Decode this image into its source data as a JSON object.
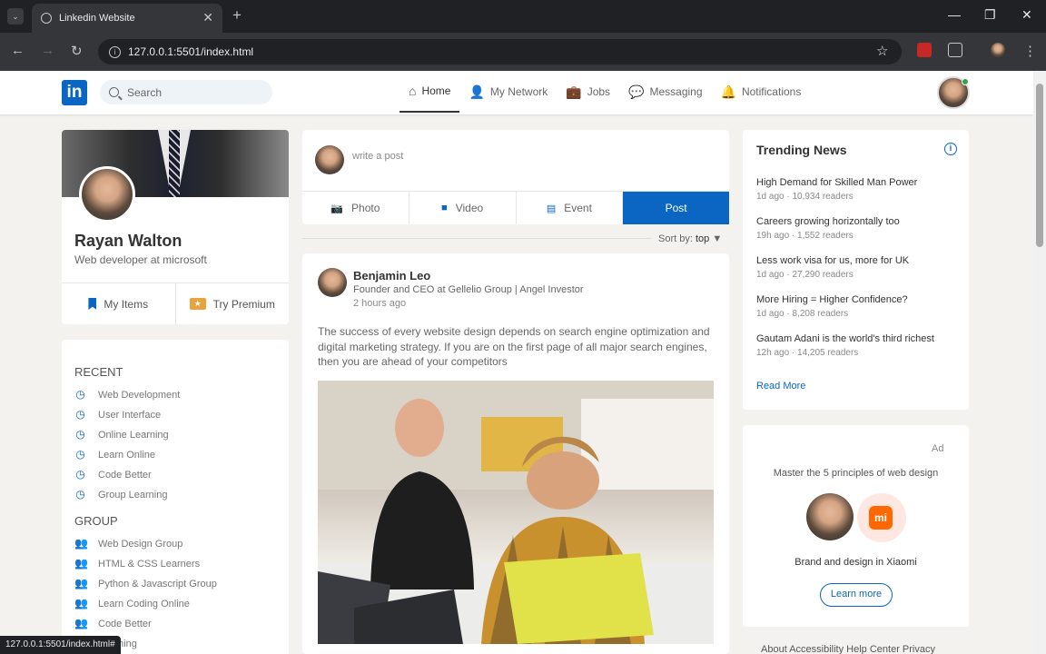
{
  "browser": {
    "tab_title": "Linkedin Website",
    "url": "127.0.0.1:5501/index.html",
    "status_url": "127.0.0.1:5501/index.html#"
  },
  "navbar": {
    "logo": "in",
    "search_placeholder": "Search",
    "items": [
      {
        "label": "Home",
        "icon": "home-icon"
      },
      {
        "label": "My Network",
        "icon": "people-icon"
      },
      {
        "label": "Jobs",
        "icon": "briefcase-icon"
      },
      {
        "label": "Messaging",
        "icon": "message-icon"
      },
      {
        "label": "Notifications",
        "icon": "bell-icon"
      }
    ]
  },
  "profile": {
    "name": "Rayan Walton",
    "role": "Web developer at microsoft",
    "my_items": "My Items",
    "try_premium": "Try Premium"
  },
  "sidebar": {
    "recent_title": "RECENT",
    "recent": [
      "Web Development",
      "User Interface",
      "Online Learning",
      "Learn Online",
      "Code Better",
      "Group Learning"
    ],
    "group_title": "GROUP",
    "groups": [
      "Web Design Group",
      "HTML & CSS Learners",
      "Python & Javascript Group",
      "Learn Coding Online",
      "Code Better",
      "Learning"
    ]
  },
  "composer": {
    "placeholder": "write a post",
    "photo": "Photo",
    "video": "Video",
    "event": "Event",
    "post": "Post"
  },
  "sort": {
    "label": "Sort by:",
    "value": "top"
  },
  "post": {
    "author": "Benjamin Leo",
    "title": "Founder and CEO at Gellelio Group | Angel Investor",
    "time": "2 hours ago",
    "text": "The success of every website design depends on search engine optimization and digital marketing strategy. If you are on the first page of all major search engines, then you are ahead of your competitors"
  },
  "trending": {
    "title": "Trending News",
    "items": [
      {
        "headline": "High Demand for Skilled Man Power",
        "meta": "1d ago · 10,934 readers"
      },
      {
        "headline": "Careers growing horizontally too",
        "meta": "19h ago · 1,552 readers"
      },
      {
        "headline": "Less work visa for us, more for UK",
        "meta": "1d ago · 27,290 readers"
      },
      {
        "headline": "More Hiring = Higher Confidence?",
        "meta": "1d ago · 8,208 readers"
      },
      {
        "headline": "Gautam Adani is the world's third richest",
        "meta": "12h ago · 14,205 readers"
      }
    ],
    "read_more": "Read More"
  },
  "ad": {
    "label": "Ad",
    "text": "Master the 5 principles of web design",
    "logo_text": "mi",
    "brand": "Brand and design in Xiaomi",
    "button": "Learn more"
  },
  "footer": {
    "text": "About  Accessibility  Help Center  Privacy"
  }
}
